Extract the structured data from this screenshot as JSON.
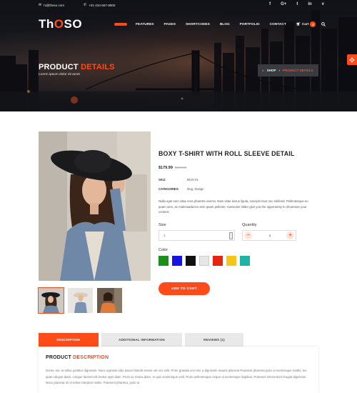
{
  "colors": {
    "accent": "#ff4a1a",
    "dark": "#222222"
  },
  "topbar": {
    "email": "hi@theso.com",
    "phone": "+01-234-567-8900",
    "social": [
      "f",
      "G+",
      "t",
      "in",
      "v"
    ]
  },
  "logo": {
    "text_a": "Th",
    "text_o": "O",
    "text_b": "SO"
  },
  "nav": {
    "items": [
      "FEATURES",
      "PAGES",
      "SHORTCODES",
      "BLOG",
      "PORTFOLIO",
      "CONTACT"
    ],
    "cart_label": "Cart",
    "cart_count": "0"
  },
  "hero": {
    "title_a": "PRODUCT",
    "title_b": "DETAILS",
    "subtitle": "Lorem ipsum dolor sit amet",
    "breadcrumb": {
      "shop": "SHOP",
      "current": "PRODUCT DETAILS"
    }
  },
  "product": {
    "title": "BOXY T-SHIRT WITH ROLL SLEEVE DETAIL",
    "price": "$179.99",
    "old_price": "$199.99",
    "sku_label": "SKU:",
    "sku": "MUG-01",
    "categories_label": "CATEGORIES:",
    "categories": "Mug, Design",
    "description": "Nulla eget sem vitae eros pharetra viverra. Nam vitae luctus ligula, suscipit risus nec eleifend. Pellentesque eu quam sem, ac malesuada leo sem quam pellente. Awesome slider give you the opportunity to showcase your content.",
    "size_label": "Size",
    "size_value": "1",
    "quantity_label": "Quantity",
    "quantity": "1",
    "color_label": "Color",
    "colors": [
      "#1a8f1a",
      "#1414e6",
      "#111111",
      "#e6e6e6",
      "#e62410",
      "#f5c51c",
      "#1fb3a6"
    ],
    "add_to_cart": "ADD TO CART"
  },
  "tabs": [
    "DESCRIPTION",
    "ADDITIONAL INFORMATION",
    "REVIEWS (1)"
  ],
  "panel": {
    "title_a": "PRODUCT",
    "title_b": "DESCRIPTION",
    "text": "Donec nec ut tellus porttitor dignissim. Nunc egestas odio ipsum blandit ornare vel orci velit. Proin gravida orci nisl, a dignissim mauris placerat Praesent pharetra justo ut scelerisque mattis, leo quam aliquet diam, congue laoreet elit metus eget diam. Proin ac metus diam. In quis scelerisque velit. Proin pellentesque neque ut scelerisque dapibus. Praesent elementum feugiat dignissim. Nunc placerat mi et tellus interdum mollis. Praesent pharetra, justo ut"
  }
}
